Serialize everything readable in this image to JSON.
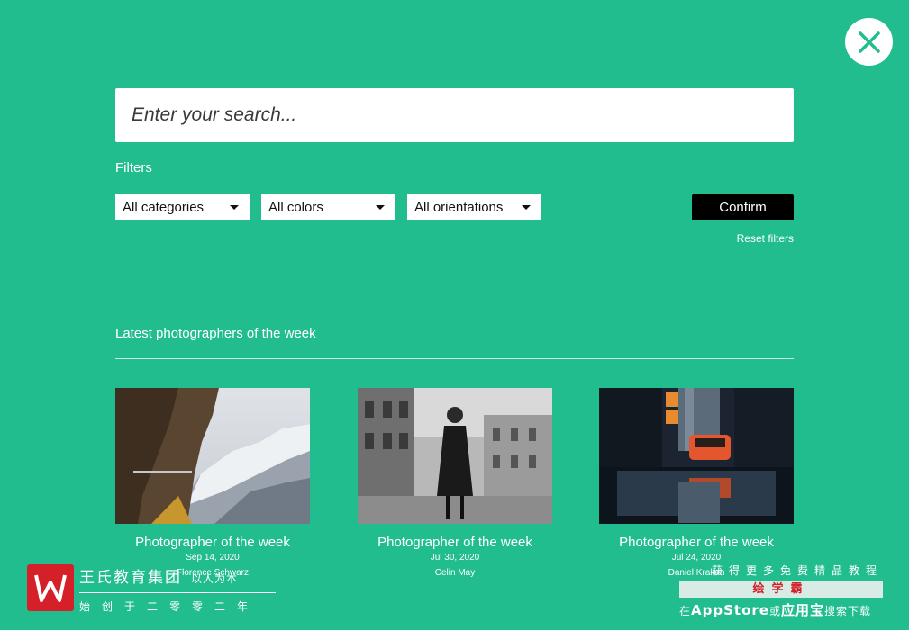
{
  "search": {
    "placeholder": "Enter your search..."
  },
  "filters": {
    "label": "Filters",
    "categories": "All categories",
    "colors": "All colors",
    "orientations": "All orientations",
    "confirm": "Confirm",
    "reset": "Reset filters"
  },
  "section": {
    "title": "Latest photographers of the week"
  },
  "cards": [
    {
      "caption": "Photographer of the week",
      "date": "Sep 14, 2020",
      "name": "Florence Schwarz"
    },
    {
      "caption": "Photographer of the week",
      "date": "Jul 30, 2020",
      "name": "Celin May"
    },
    {
      "caption": "Photographer of the week",
      "date": "Jul 24, 2020",
      "name": "Daniel Krakan"
    }
  ],
  "watermark_left": {
    "title": "王氏教育集团",
    "motto": "以人为本",
    "since": "始创于二零零二年"
  },
  "watermark_right": {
    "line1": "获得更多免费精品教程",
    "brand": "绘学霸",
    "line3_pre": "在",
    "line3_store": "AppStore",
    "line3_mid": "或",
    "line3_app": "应用宝",
    "line3_post": "搜索下载"
  },
  "colors": {
    "background": "#22bd8f",
    "button": "#000000",
    "close_icon": "#22bd8f"
  }
}
